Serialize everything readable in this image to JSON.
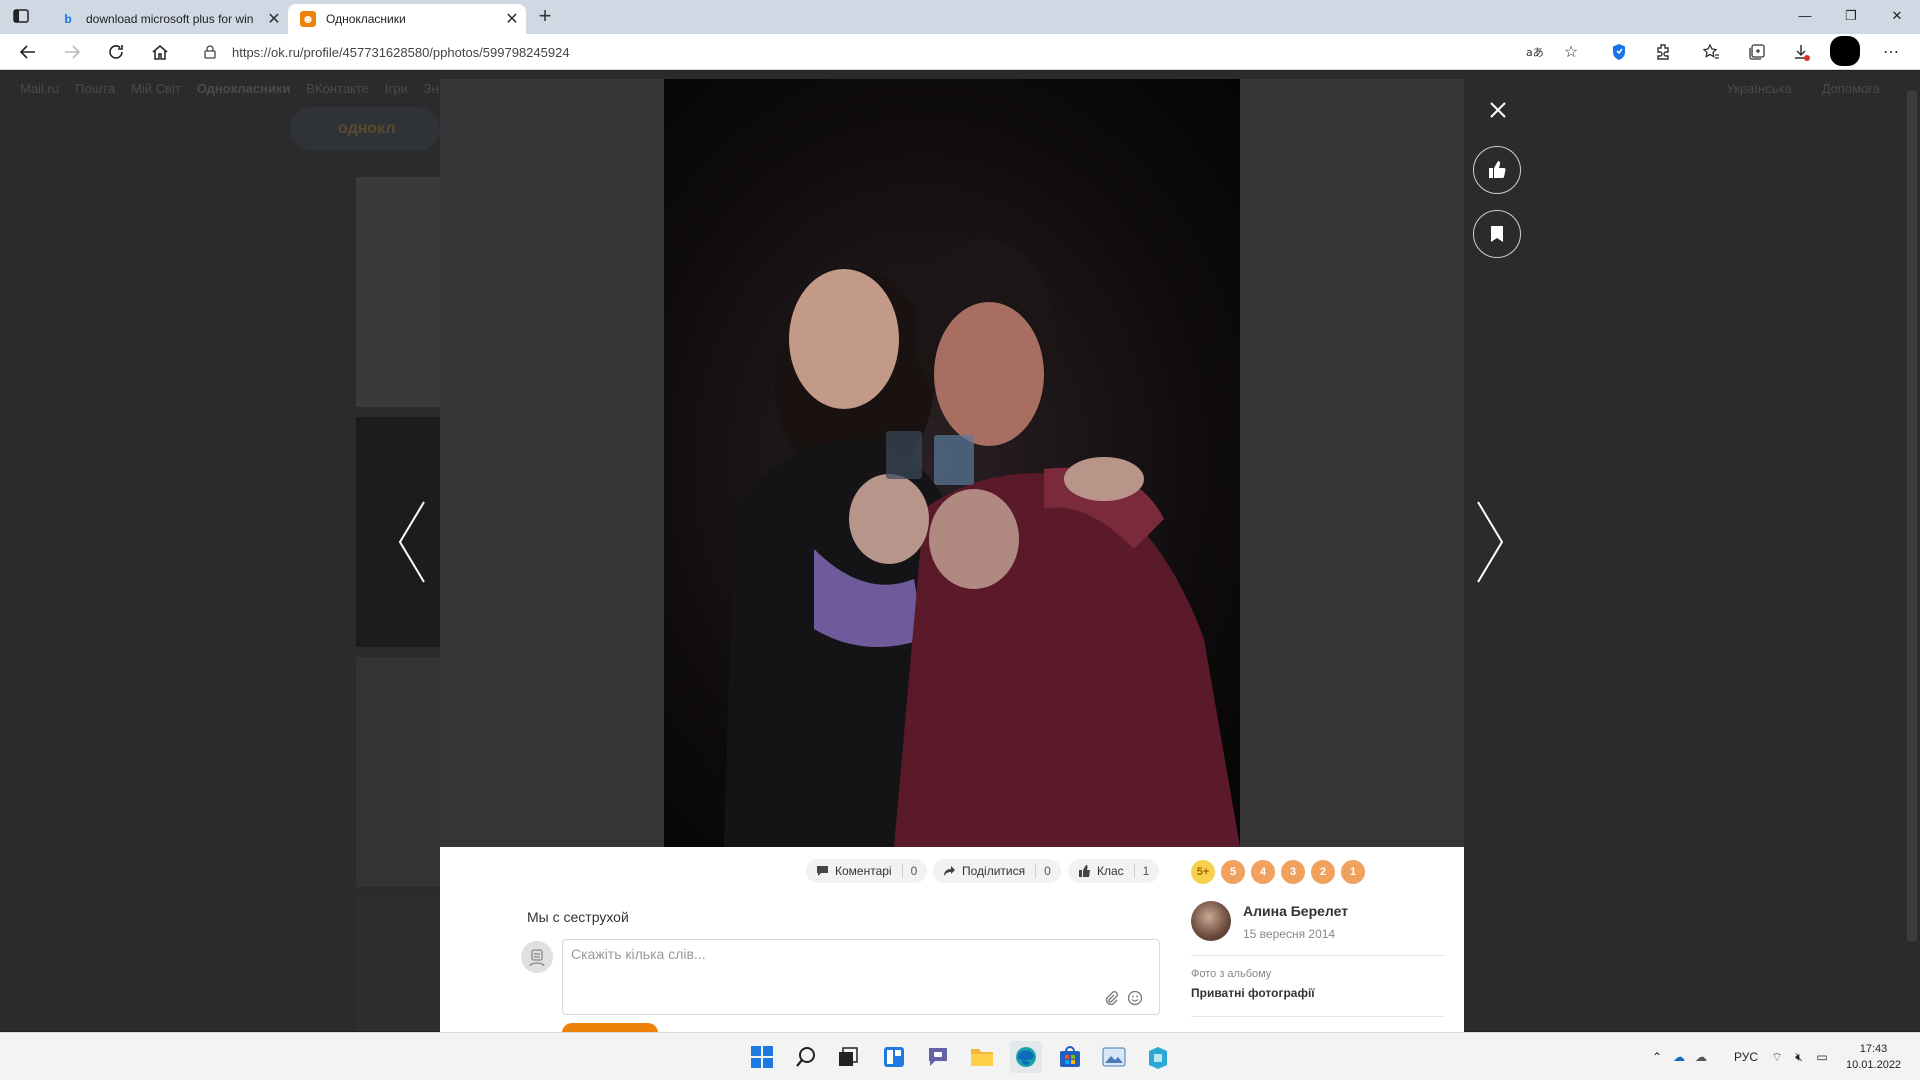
{
  "browser": {
    "tabs": [
      {
        "label": "download microsoft plus for win",
        "favicon": "bing-icon",
        "active": false
      },
      {
        "label": "Однокласники",
        "favicon": "ok-icon",
        "active": true
      }
    ],
    "url": "https://ok.ru/profile/457731628580/pphotos/599798245924",
    "colors": {
      "tabstrip": "#cfd9e3",
      "accent": "#ee8208"
    }
  },
  "site": {
    "topnav": [
      "Mail.ru",
      "Пошта",
      "Мій Світ",
      "Однокласники",
      "ВКонтакте",
      "Ігри",
      "Зн"
    ],
    "language": "Українська",
    "help": "Допомога",
    "logo_text": "однокл"
  },
  "viewer": {
    "actions": [
      {
        "label": "Коментарі",
        "count": "0",
        "icon": "comment-icon"
      },
      {
        "label": "Поділитися",
        "count": "0",
        "icon": "share-icon"
      },
      {
        "label": "Клас",
        "count": "1",
        "icon": "thumb-up-icon"
      }
    ],
    "grades": [
      "5+",
      "5",
      "4",
      "3",
      "2",
      "1"
    ],
    "caption": "Мы с сеструхой",
    "comment_placeholder": "Скажіть кілька слів...",
    "author": {
      "name": "Алина Берелет",
      "date": "15 вересня 2014"
    },
    "album_label": "Фото з альбому",
    "album_name": "Приватні фотографії"
  },
  "taskbar": {
    "apps": [
      "start-icon",
      "search-icon",
      "task-view-icon",
      "widgets-icon",
      "teams-chat-icon",
      "file-explorer-icon",
      "edge-icon",
      "store-icon",
      "photos-icon",
      "app-icon"
    ],
    "language": "РУС",
    "time": "17:43",
    "date": "10.01.2022"
  }
}
